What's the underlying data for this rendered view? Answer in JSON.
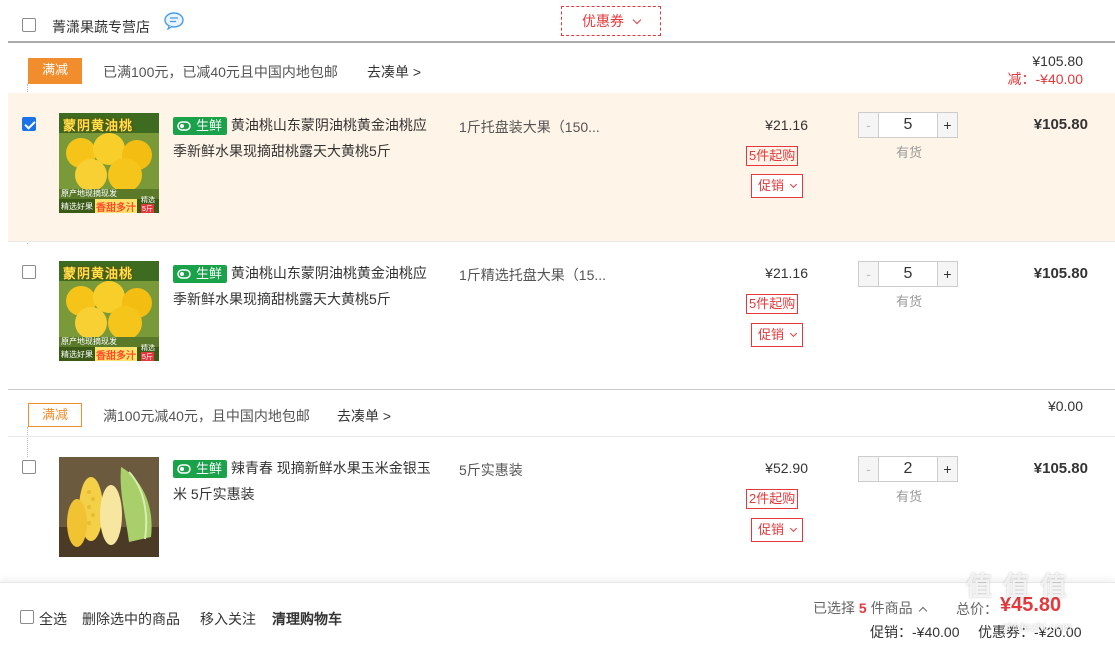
{
  "shop": {
    "name": "菁潇果蔬专营店",
    "coupon_label": "优惠券"
  },
  "groups": [
    {
      "promo_tag": "满减",
      "promo_text": "已满100元，已减40元且中国内地包邮",
      "promo_link": "去凑单 >",
      "group_total": "¥105.80",
      "group_discount": "减：-¥40.00",
      "items": [
        {
          "checked": true,
          "badge": "生鲜",
          "title": "黄油桃山东蒙阴油桃黄金油桃应季新鲜水果现摘甜桃露天大黄桃5斤",
          "spec": "1斤托盘装大果（150...",
          "price": "¥21.16",
          "min_buy": "5件起购",
          "promo_label": "促销",
          "qty": "5",
          "stock": "有货",
          "subtotal": "¥105.80",
          "thumb_text_top": "蒙阴黄油桃",
          "thumb_text_mid": "原产地现摘现发",
          "thumb_text_bottom": "精选好果",
          "thumb_text_sweet": "香甜多汁",
          "thumb_text_corner1": "精选",
          "thumb_text_corner2": "5斤"
        },
        {
          "checked": false,
          "badge": "生鲜",
          "title": "黄油桃山东蒙阴油桃黄金油桃应季新鲜水果现摘甜桃露天大黄桃5斤",
          "spec": "1斤精选托盘大果（15...",
          "price": "¥21.16",
          "min_buy": "5件起购",
          "promo_label": "促销",
          "qty": "5",
          "stock": "有货",
          "subtotal": "¥105.80",
          "thumb_text_top": "蒙阴黄油桃",
          "thumb_text_mid": "原产地现摘现发",
          "thumb_text_bottom": "精选好果",
          "thumb_text_sweet": "香甜多汁",
          "thumb_text_corner1": "精选",
          "thumb_text_corner2": "5斤"
        }
      ]
    },
    {
      "promo_tag": "满减",
      "promo_text": "满100元减40元，且中国内地包邮",
      "promo_link": "去凑单 >",
      "group_total": "¥0.00",
      "items": [
        {
          "checked": false,
          "badge": "生鲜",
          "title": "辣青春 现摘新鲜水果玉米金银玉米 5斤实惠装",
          "spec": "5斤实惠装",
          "price": "¥52.90",
          "min_buy": "2件起购",
          "promo_label": "促销",
          "qty": "2",
          "stock": "有货",
          "subtotal": "¥105.80"
        }
      ]
    }
  ],
  "footer": {
    "select_all": "全选",
    "delete_selected": "删除选中的商品",
    "move_to_favorites": "移入关注",
    "clear_cart": "清理购物车",
    "selected_prefix": "已选择",
    "selected_count": "5",
    "selected_suffix": "件商品",
    "total_label": "总价：",
    "total_value": "¥45.80",
    "promo_discount": "促销：-¥40.00",
    "coupon_discount": "优惠券：-¥20.00",
    "watermark": "值 值 值",
    "watermark_url": "zhidezhi.com"
  },
  "colors": {
    "accent_red": "#e4393c",
    "promo_orange": "#f18d2c",
    "fresh_green": "#1aa24b",
    "selected_row_bg": "#fff4e8"
  }
}
